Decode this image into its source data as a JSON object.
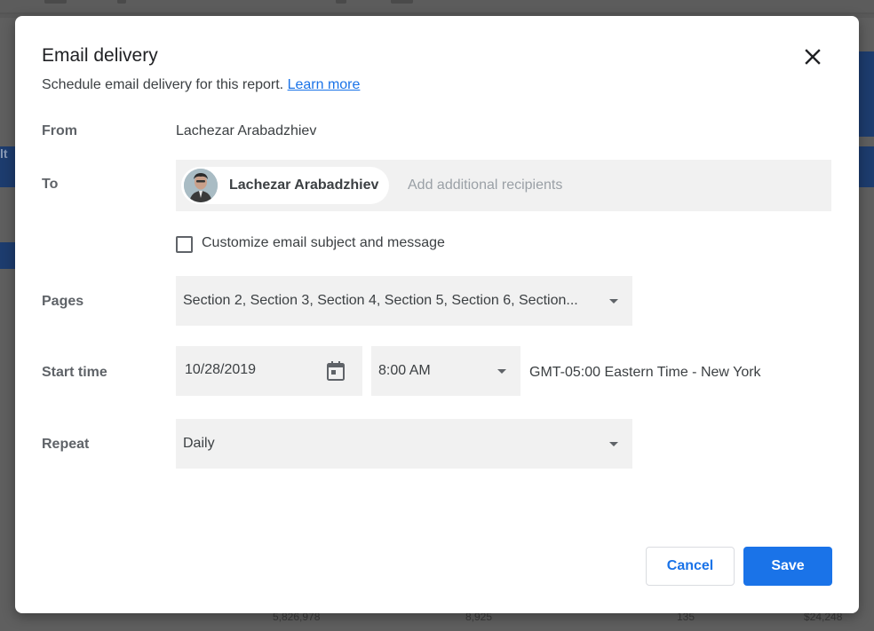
{
  "background": {
    "table_values": [
      "5,826,978",
      "8,925",
      "135",
      "$24,248"
    ],
    "band_text": "lt"
  },
  "dialog": {
    "title": "Email delivery",
    "subtitle": "Schedule email delivery for this report.",
    "learn_more": "Learn more",
    "close_icon": "close-icon",
    "from": {
      "label": "From",
      "value": "Lachezar Arabadzhiev"
    },
    "to": {
      "label": "To",
      "recipients": [
        {
          "name": "Lachezar Arabadzhiev",
          "avatar": "user-avatar"
        }
      ],
      "placeholder": "Add additional recipients",
      "value": ""
    },
    "customize": {
      "label": "Customize email subject and message",
      "checked": false
    },
    "pages": {
      "label": "Pages",
      "selected": "Section 2, Section 3, Section 4, Section 5, Section 6, Section..."
    },
    "start_time": {
      "label": "Start time",
      "date": "10/28/2019",
      "time": "8:00 AM",
      "timezone": "GMT-05:00 Eastern Time - New York",
      "calendar_icon": "calendar-icon"
    },
    "repeat": {
      "label": "Repeat",
      "selected": "Daily"
    },
    "buttons": {
      "cancel": "Cancel",
      "save": "Save"
    }
  },
  "colors": {
    "accent": "#1a73e8",
    "field_bg": "#f1f1f1",
    "overlay": "#5f5f5f"
  }
}
